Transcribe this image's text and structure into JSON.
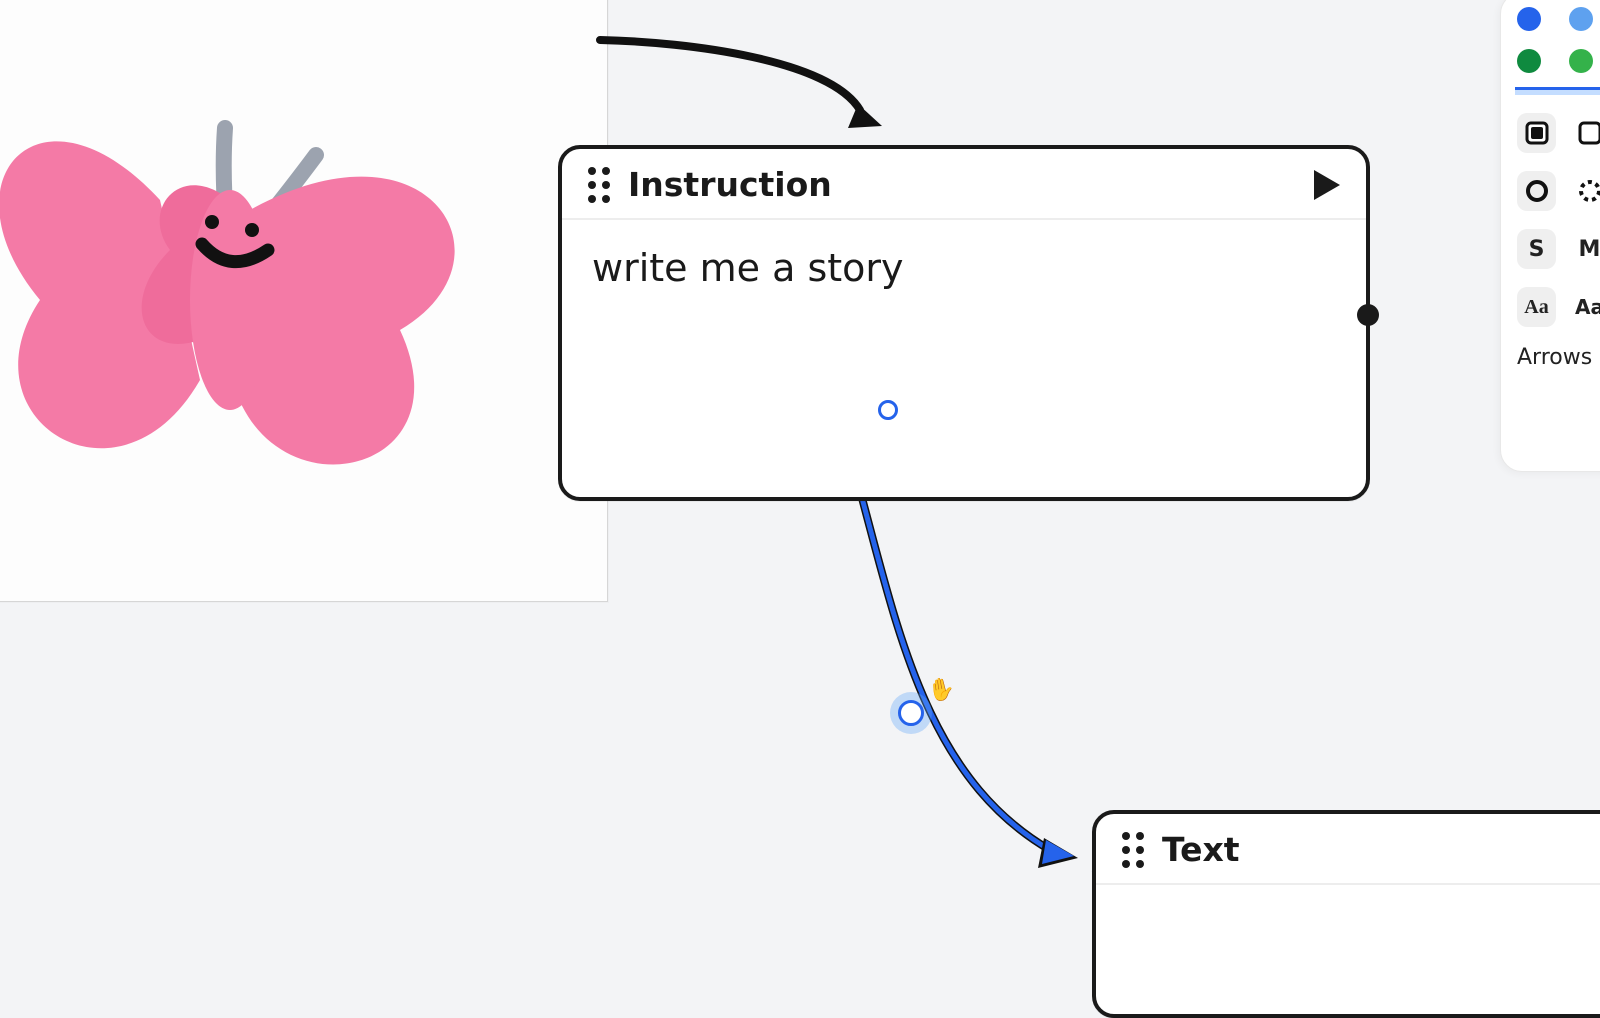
{
  "cards": {
    "instruction": {
      "title": "Instruction",
      "body": "write me a story"
    },
    "text": {
      "title": "Text"
    }
  },
  "panel": {
    "colors": {
      "blue": "#2563eb",
      "blue_light": "#5ea1ef",
      "green": "#0f8a3f",
      "green_light": "#34b24a"
    },
    "sizes": {
      "s": "S",
      "m": "M"
    },
    "font": {
      "fancy": "Aa",
      "plain": "Aa"
    },
    "arrows_label": "Arrows"
  },
  "icons": {
    "play": "play-icon",
    "drag": "drag-handle-icon",
    "rect_filled": "rectangle-filled-icon",
    "rect_outline": "rectangle-outline-icon",
    "circle_filled": "circle-filled-icon",
    "circle_dashed": "circle-dashed-icon",
    "hand": "hand-cursor-icon"
  }
}
